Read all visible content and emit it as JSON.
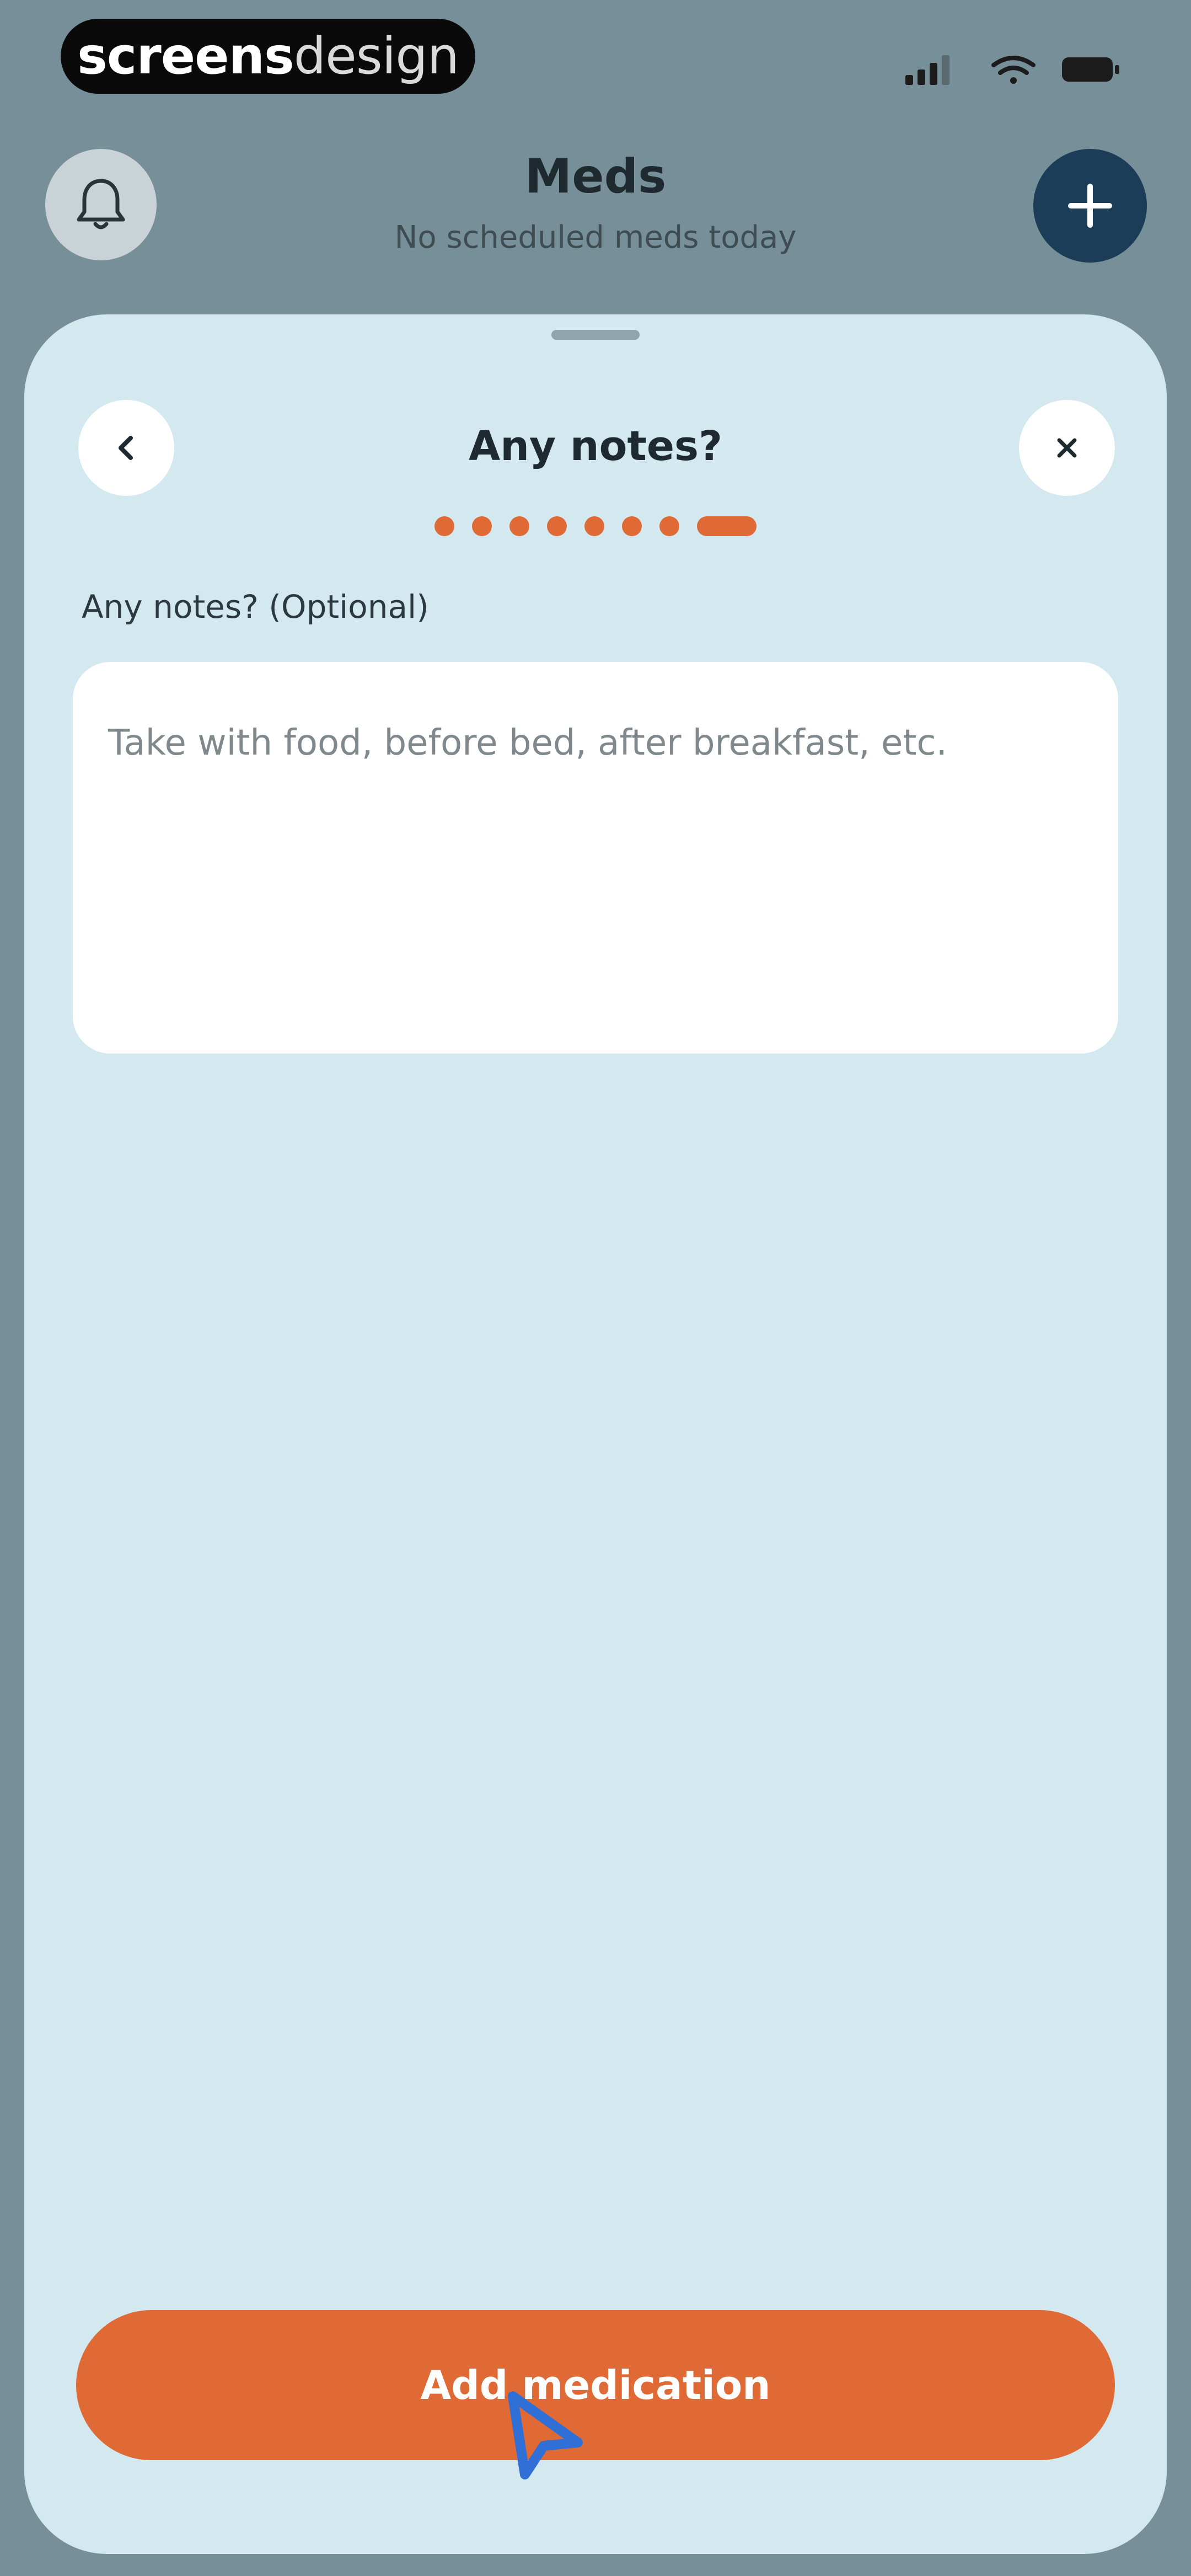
{
  "status_bar": {
    "watermark_bold": "screens",
    "watermark_light": "design"
  },
  "header": {
    "title": "Meds",
    "subtitle": "No scheduled meds today",
    "accent": "#1b3d57"
  },
  "sheet": {
    "title": "Any notes?",
    "progress": {
      "current_step": 8,
      "total_steps": 8
    },
    "notes": {
      "label": "Any notes? (Optional)",
      "value": "",
      "placeholder": "Take with food, before bed, after breakfast, etc."
    },
    "primary_button_label": "Add medication",
    "accent": "#e06a35"
  }
}
